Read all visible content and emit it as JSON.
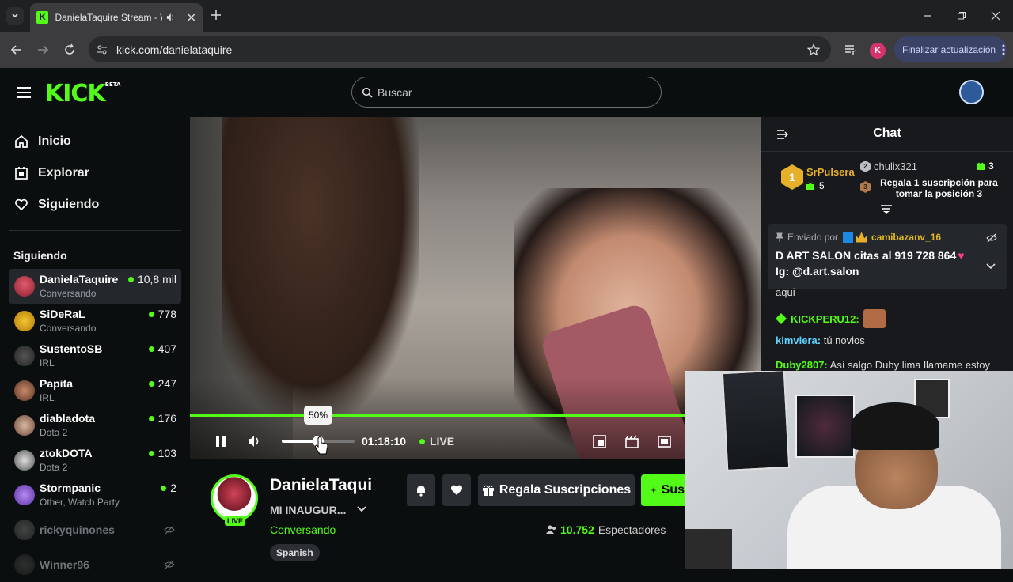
{
  "browser": {
    "tab_title": "DanielaTaquire Stream - W",
    "url": "kick.com/danielataquire",
    "update_label": "Finalizar actualización",
    "profile_initial": "K"
  },
  "header": {
    "logo": "KICK",
    "logo_badge": "BETA",
    "search_placeholder": "Buscar"
  },
  "sidebar": {
    "nav": [
      {
        "label": "Inicio",
        "icon": "home-icon"
      },
      {
        "label": "Explorar",
        "icon": "compass-icon"
      },
      {
        "label": "Siguiendo",
        "icon": "heart-icon"
      }
    ],
    "following_title": "Siguiendo",
    "following": [
      {
        "name": "DanielaTaquire",
        "category": "Conversando",
        "viewers": "10,8 mil",
        "live": true
      },
      {
        "name": "SiDeRaL",
        "category": "Conversando",
        "viewers": "778",
        "live": true
      },
      {
        "name": "SustentoSB",
        "category": "IRL",
        "viewers": "407",
        "live": true
      },
      {
        "name": "Papita",
        "category": "IRL",
        "viewers": "247",
        "live": true
      },
      {
        "name": "diabladota",
        "category": "Dota 2",
        "viewers": "176",
        "live": true
      },
      {
        "name": "ztokDOTA",
        "category": "Dota 2",
        "viewers": "103",
        "live": true
      },
      {
        "name": "Stormpanic",
        "category": "Other, Watch Party",
        "viewers": "2",
        "live": true
      },
      {
        "name": "rickyquinones",
        "category": "",
        "viewers": "",
        "live": false
      },
      {
        "name": "Winner96",
        "category": "",
        "viewers": "",
        "live": false
      }
    ]
  },
  "player": {
    "volume_tooltip": "50%",
    "volume_level": 0.5,
    "time": "01:18:10",
    "live_label": "LIVE"
  },
  "stream": {
    "channel": "DanielaTaquire",
    "title": "MI INAUGUR...",
    "category": "Conversando",
    "language": "Spanish",
    "live_badge": "LIVE",
    "gift_label": "Regala Suscripciones",
    "subscribe_label": "Sus",
    "viewers": "10.752",
    "viewers_label": "Espectadores"
  },
  "chat": {
    "title": "Chat",
    "leaderboard": {
      "first": {
        "rank": "1",
        "name": "SrPulsera",
        "count": "5"
      },
      "second": {
        "rank": "2",
        "name": "chulix321",
        "count": "3"
      },
      "third_rank": "3",
      "third_text": "Regala 1 suscripción para tomar la posición 3"
    },
    "pinned": {
      "label": "Enviado por",
      "user": "camibazanv_16",
      "line1": "D ART SALON citas al 919 728 864",
      "line2": "Ig: @d.art.salon"
    },
    "messages": [
      {
        "user": "",
        "text": "aqui"
      },
      {
        "user": "KICKPERU12:",
        "text": ""
      },
      {
        "user": "kimviera:",
        "text": "tú novios"
      },
      {
        "user": "Duby2807:",
        "text": "Así salgo Duby lima llamame estoy"
      }
    ]
  },
  "colors": {
    "accent": "#53fc18",
    "background": "#0b0e0f",
    "chat_bg": "#17191c"
  }
}
